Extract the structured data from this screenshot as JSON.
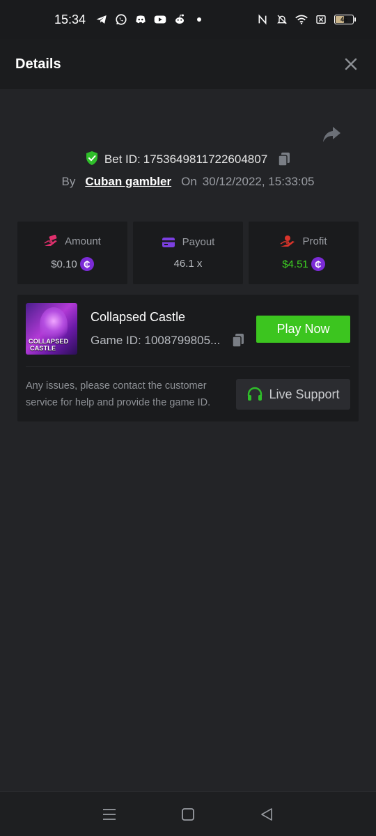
{
  "status_bar": {
    "time": "15:34",
    "notification_icons": [
      "telegram-icon",
      "whatsapp-icon",
      "discord-icon",
      "youtube-icon",
      "reddit-icon",
      "dot-icon"
    ],
    "system_icons": [
      "nfc-icon",
      "bell-muted-icon",
      "wifi-icon",
      "sim-x-icon",
      "battery-icon"
    ],
    "battery_level": "46"
  },
  "header": {
    "title": "Details",
    "close_icon": "close-icon"
  },
  "bet": {
    "id_label": "Bet ID:",
    "id_value": "1753649811722604807",
    "by_label": "By",
    "user": "Cuban gambler",
    "on_label": "On",
    "datetime": "30/12/2022, 15:33:05",
    "verified_icon": "shield-check-icon",
    "copy_icon": "copy-icon",
    "share_icon": "share-icon"
  },
  "stats": [
    {
      "label": "Amount",
      "value": "$0.10",
      "icon": "hand-money-icon",
      "has_coin": true,
      "color": "#e0306d"
    },
    {
      "label": "Payout",
      "value": "46.1 x",
      "icon": "card-icon",
      "has_coin": false,
      "color": "#7b3fe0"
    },
    {
      "label": "Profit",
      "value": "$4.51",
      "icon": "hand-heart-icon",
      "has_coin": true,
      "color": "#d9342b"
    }
  ],
  "coin_symbol": "₵",
  "game": {
    "title": "Collapsed Castle",
    "id_label": "Game ID:",
    "id_value": "1008799805...",
    "thumb_line1": "COLLAPSED",
    "thumb_line2": "CASTLE",
    "play_button": "Play Now",
    "help_text": "Any issues, please contact the customer service for help and provide the game ID.",
    "support_button": "Live Support",
    "support_icon": "headset-icon"
  },
  "colors": {
    "accent_green": "#3cc51f",
    "profit_green": "#3ed322",
    "background": "#232427",
    "panel": "#1a1b1d"
  },
  "nav": {
    "recent_icon": "menu-icon",
    "home_icon": "home-square-icon",
    "back_icon": "back-triangle-icon"
  }
}
